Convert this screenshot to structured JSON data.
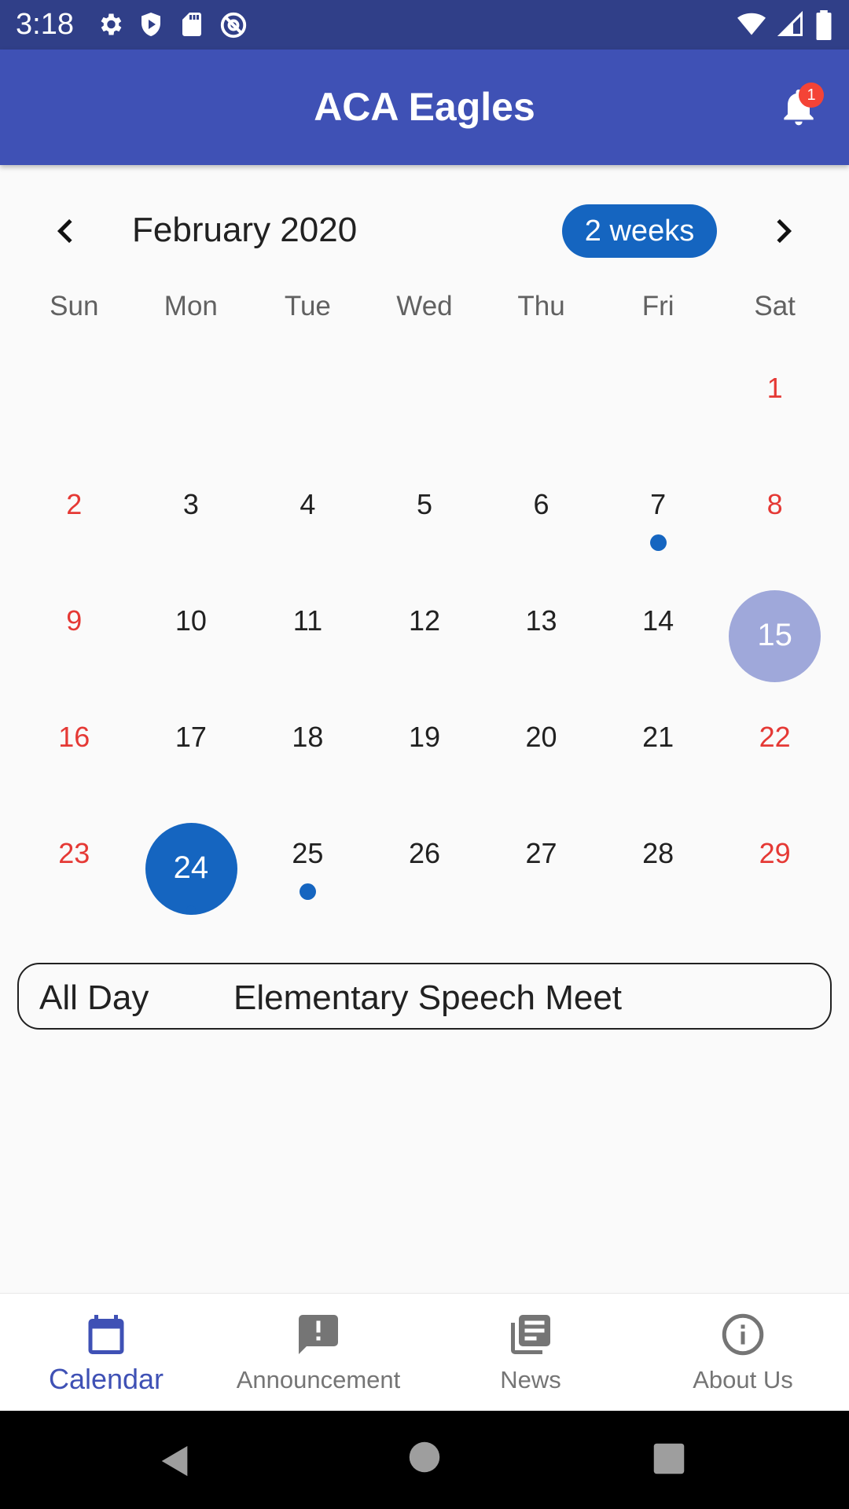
{
  "status_bar": {
    "time": "3:18"
  },
  "app_bar": {
    "title": "ACA Eagles",
    "notification_count": "1"
  },
  "calendar": {
    "month_title": "February 2020",
    "format_button": "2 weeks",
    "weekdays": [
      "Sun",
      "Mon",
      "Tue",
      "Wed",
      "Thu",
      "Fri",
      "Sat"
    ],
    "weeks": [
      [
        "",
        "",
        "",
        "",
        "",
        "",
        "1"
      ],
      [
        "2",
        "3",
        "4",
        "5",
        "6",
        "7",
        "8"
      ],
      [
        "9",
        "10",
        "11",
        "12",
        "13",
        "14",
        "15"
      ],
      [
        "16",
        "17",
        "18",
        "19",
        "20",
        "21",
        "22"
      ],
      [
        "23",
        "24",
        "25",
        "26",
        "27",
        "28",
        "29"
      ]
    ],
    "today": "15",
    "selected": "24",
    "event_days": [
      "7",
      "24",
      "25"
    ]
  },
  "event": {
    "time": "All Day",
    "title": "Elementary Speech Meet"
  },
  "bottom_nav": {
    "items": [
      {
        "label": "Calendar",
        "icon": "calendar-icon",
        "active": true
      },
      {
        "label": "Announcement",
        "icon": "announcement-icon",
        "active": false
      },
      {
        "label": "News",
        "icon": "news-icon",
        "active": false
      },
      {
        "label": "About Us",
        "icon": "info-icon",
        "active": false
      }
    ]
  },
  "colors": {
    "status_bar": "#303f88",
    "app_bar": "#3f51b5",
    "accent": "#1565c0",
    "today_circle": "#9fa8da",
    "weekend": "#e53935"
  }
}
